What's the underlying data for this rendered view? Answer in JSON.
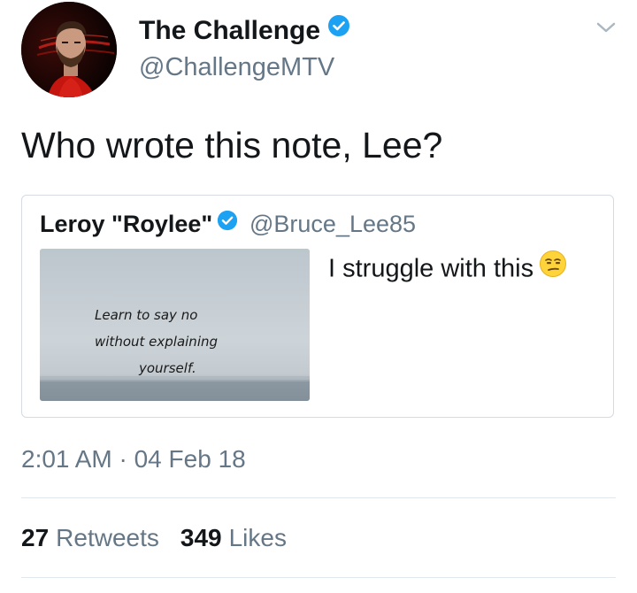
{
  "tweet": {
    "author": {
      "name": "The Challenge",
      "handle": "@ChallengeMTV",
      "verified": true
    },
    "text": "Who wrote this note, Lee?",
    "quoted": {
      "name": "Leroy \"Roylee\"",
      "handle": "@Bruce_Lee85",
      "verified": true,
      "text": "I struggle with this",
      "emoji": "unamused-face",
      "image_text": [
        "Learn to say no",
        "without explaining",
        "yourself."
      ]
    },
    "timestamp": "2:01 AM · 04 Feb 18",
    "stats": {
      "retweets_count": "27",
      "retweets_label": "Retweets",
      "likes_count": "349",
      "likes_label": "Likes"
    }
  },
  "colors": {
    "verified_blue": "#1da1f2",
    "secondary_text": "#657786",
    "primary_text": "#14171a",
    "divider": "#e1e8ed"
  },
  "icons": {
    "verified": "verified-badge-icon",
    "menu": "chevron-down-icon"
  }
}
